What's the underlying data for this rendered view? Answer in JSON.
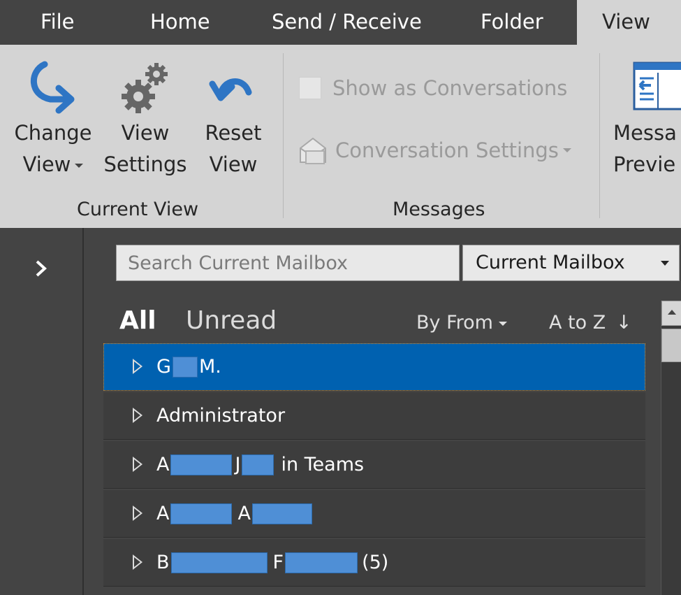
{
  "tabs": [
    {
      "label": "File"
    },
    {
      "label": "Home"
    },
    {
      "label": "Send / Receive"
    },
    {
      "label": "Folder"
    },
    {
      "label": "View",
      "active": true
    }
  ],
  "ribbon": {
    "current_view": {
      "group_label": "Current View",
      "change_view": {
        "line1": "Change",
        "line2": "View",
        "icon": "change-view-arrow-icon"
      },
      "view_settings": {
        "line1": "View",
        "line2": "Settings",
        "icon": "gears-icon"
      },
      "reset_view": {
        "line1": "Reset",
        "line2": "View",
        "icon": "undo-arrow-icon"
      }
    },
    "messages": {
      "group_label": "Messages",
      "show_as_conversations": "Show as Conversations",
      "conversation_settings": "Conversation Settings"
    },
    "message_preview": {
      "line1": "Messa",
      "line2": "Previe"
    }
  },
  "search": {
    "placeholder": "Search Current Mailbox",
    "scope": "Current Mailbox"
  },
  "filter": {
    "all": "All",
    "unread": "Unread",
    "arrange_by": "By From",
    "sort_order": "A to Z",
    "sort_arrow": "↓"
  },
  "groups": [
    {
      "prefix": "G",
      "middle": "",
      "suffix": "M.",
      "selected": true
    },
    {
      "prefix": "Administrator",
      "middle": "",
      "suffix": ""
    },
    {
      "prefix": "A",
      "middle": "J",
      "suffix": "in Teams"
    },
    {
      "prefix": "A",
      "middle": "A",
      "suffix": ""
    },
    {
      "prefix": "B",
      "middle": "F",
      "suffix": "(5)"
    }
  ],
  "colors": {
    "selected_row": "#0061b0",
    "ribbon_bg": "#d4d4d4",
    "dark_bg": "#444444",
    "icon_blue": "#2e75c4"
  }
}
